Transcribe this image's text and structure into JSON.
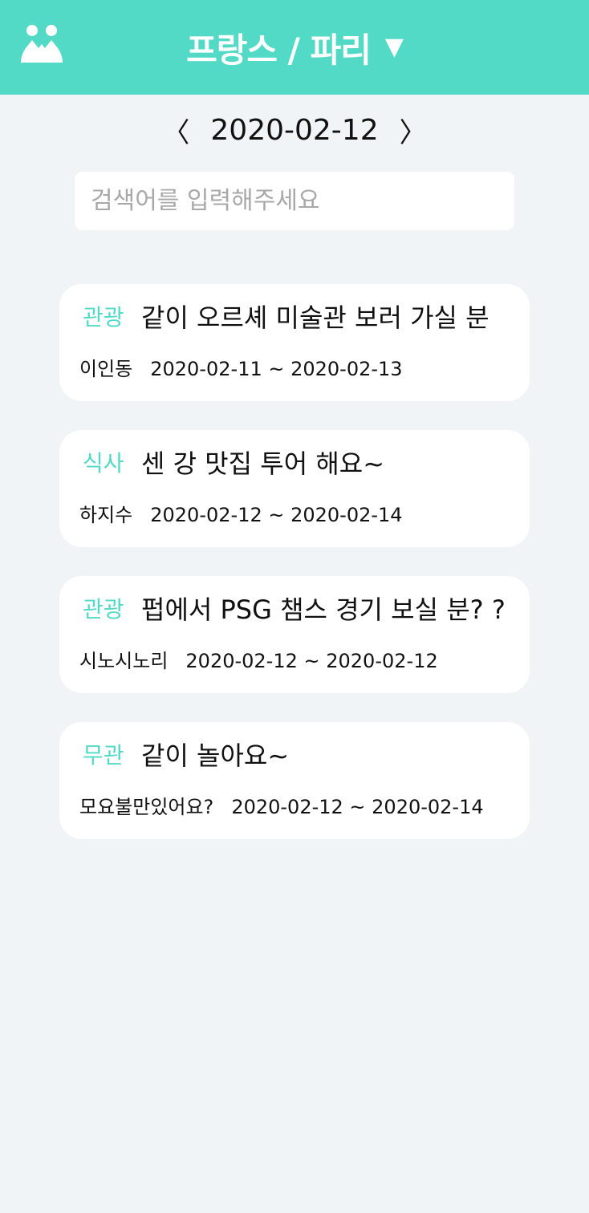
{
  "header": {
    "title": "프랑스 / 파리",
    "caret": "▼",
    "logo_icon": "people-icon",
    "color": "#52dac6"
  },
  "datebar": {
    "prev": "〈",
    "date": "2020-02-12",
    "next": "〉"
  },
  "search": {
    "placeholder": "검색어를 입력해주세요",
    "value": ""
  },
  "posts": [
    {
      "category": "관광",
      "title": "같이 오르셰 미술관 보러 가실 분",
      "author": "이인동",
      "period": "2020-02-11 ~ 2020-02-13"
    },
    {
      "category": "식사",
      "title": "센 강 맛집 투어 해요~",
      "author": "하지수",
      "period": "2020-02-12 ~ 2020-02-14"
    },
    {
      "category": "관광",
      "title": "펍에서 PSG 챔스 경기 보실 분? ?",
      "author": "시노시노리",
      "period": "2020-02-12 ~ 2020-02-12"
    },
    {
      "category": "무관",
      "title": "같이 놀아요~",
      "author": "모요불만있어요?",
      "period": "2020-02-12 ~ 2020-02-14"
    }
  ],
  "colors": {
    "accent": "#52dac6",
    "background": "#f0f4f7"
  }
}
